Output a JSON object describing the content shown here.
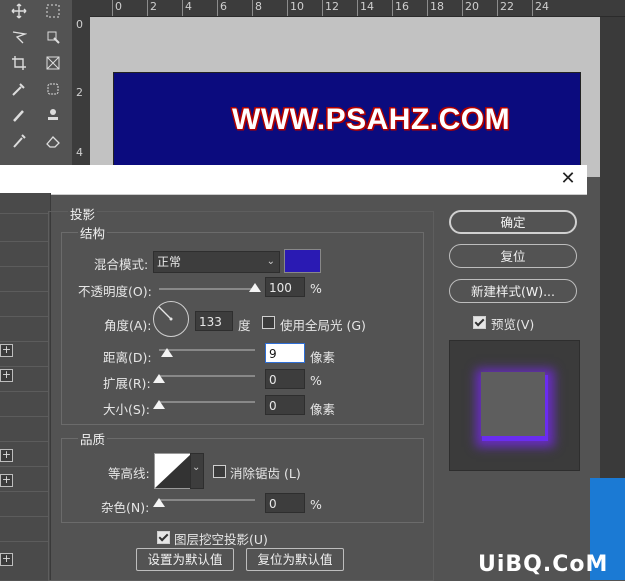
{
  "ruler": {
    "h_numbers": [
      "0",
      "2",
      "4",
      "6",
      "8",
      "10",
      "12",
      "14",
      "16",
      "18",
      "20",
      "22",
      "24"
    ],
    "v_numbers": [
      "0",
      "2",
      "4"
    ]
  },
  "canvas": {
    "text": "WWW.PSAHZ.COM",
    "bg_color": "#0b0b7e"
  },
  "tools": [
    "move-icon",
    "marquee-icon",
    "lasso-icon",
    "magic-wand-icon",
    "crop-icon",
    "frame-icon",
    "eyedropper-icon",
    "patch-icon",
    "brush-icon",
    "stamp-icon",
    "history-brush-icon",
    "eraser-icon"
  ],
  "dialog": {
    "close_symbol": "✕",
    "drop_shadow": {
      "title": "投影",
      "structure_title": "结构",
      "blend_mode_label": "混合模式:",
      "blend_mode_value": "正常",
      "shadow_color": "#2a1ab3",
      "opacity_label": "不透明度(O):",
      "opacity_value": "100",
      "opacity_unit": "%",
      "opacity_fraction": 1.0,
      "angle_label": "角度(A):",
      "angle_value": "133",
      "angle_unit": "度",
      "global_light_label": "使用全局光 (G)",
      "global_light_checked": false,
      "distance_label": "距离(D):",
      "distance_value": "9",
      "distance_unit": "像素",
      "distance_fraction": 0.08,
      "spread_label": "扩展(R):",
      "spread_value": "0",
      "spread_unit": "%",
      "spread_fraction": 0.0,
      "size_label": "大小(S):",
      "size_value": "0",
      "size_unit": "像素",
      "size_fraction": 0.0,
      "quality_title": "品质",
      "contour_label": "等高线:",
      "antialias_label": "消除锯齿 (L)",
      "antialias_checked": false,
      "noise_label": "杂色(N):",
      "noise_value": "0",
      "noise_unit": "%",
      "noise_fraction": 0.0,
      "knockout_label": "图层挖空投影(U)",
      "knockout_checked": true,
      "make_default_label": "设置为默认值",
      "reset_default_label": "复位为默认值"
    },
    "buttons": {
      "ok": "确定",
      "reset": "复位",
      "new_style": "新建样式(W)...",
      "preview_label": "预览(V)",
      "preview_checked": true
    },
    "preview": {
      "glow_color": "#6a2df0"
    }
  },
  "watermark": "UiBQ.CoM"
}
